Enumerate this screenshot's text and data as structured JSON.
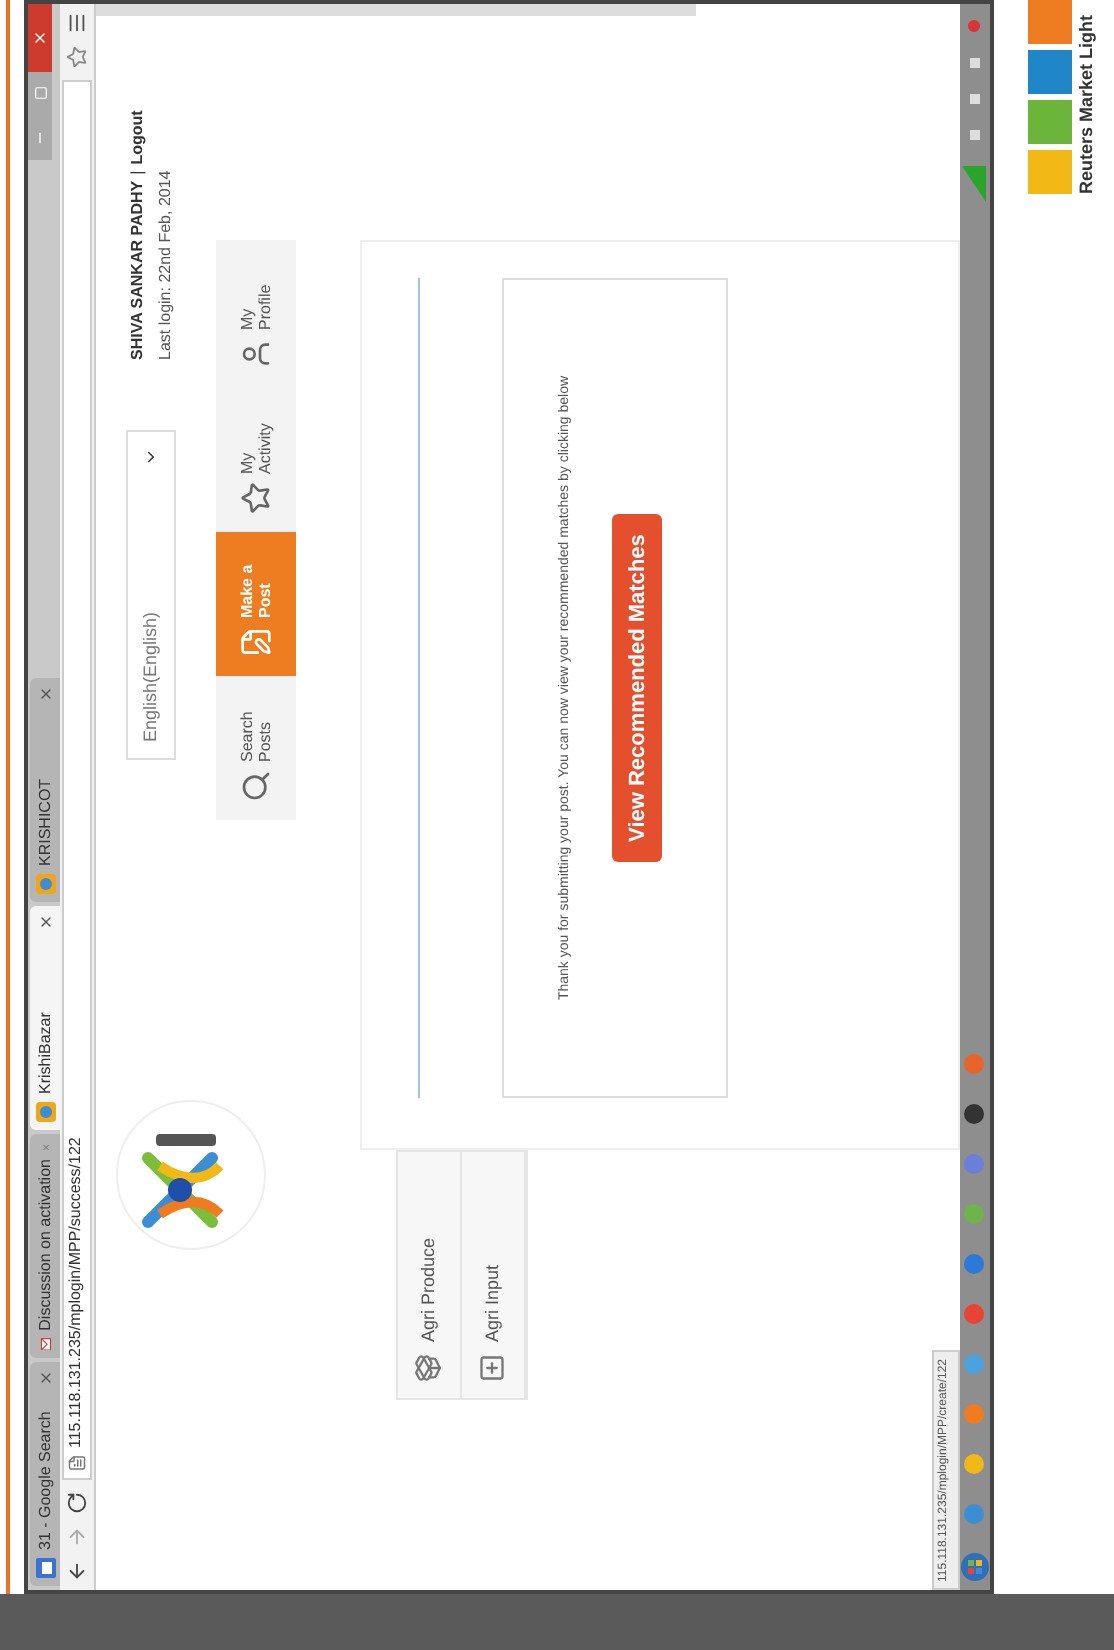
{
  "browser": {
    "tabs": [
      {
        "title": "31 - Google Search",
        "kind": "calendar",
        "selected": false
      },
      {
        "title": "Discussion on activation",
        "kind": "mail",
        "selected": false
      },
      {
        "title": "KrishiBazar",
        "kind": "site",
        "selected": true
      },
      {
        "title": "KRISHICOT",
        "kind": "site",
        "selected": false
      }
    ],
    "url": "115.118.131.235/mplogin/MPP/success/122"
  },
  "header": {
    "language": "English(English)",
    "user": "SHIVA SANKAR PADHY",
    "separator": "|",
    "logout": "Logout",
    "last_login": "Last login: 22nd Feb, 2014"
  },
  "nav": [
    {
      "label": "Search Posts",
      "kind": "search",
      "selected": false
    },
    {
      "label": "Make a Post",
      "kind": "post",
      "selected": true
    },
    {
      "label": "My Activity",
      "kind": "activity",
      "selected": false
    },
    {
      "label": "My Profile",
      "kind": "profile",
      "selected": false
    }
  ],
  "sidebar": [
    {
      "label": "Agri Produce",
      "kind": "produce"
    },
    {
      "label": "Agri Input",
      "kind": "input"
    }
  ],
  "message": "Thank you for submitting your post. You can now view your recommended matches by clicking below",
  "action": "View Recommended Matches",
  "status_url": "115.118.131.235/mplogin/MPP/create/122",
  "brand": "Reuters Market Light"
}
